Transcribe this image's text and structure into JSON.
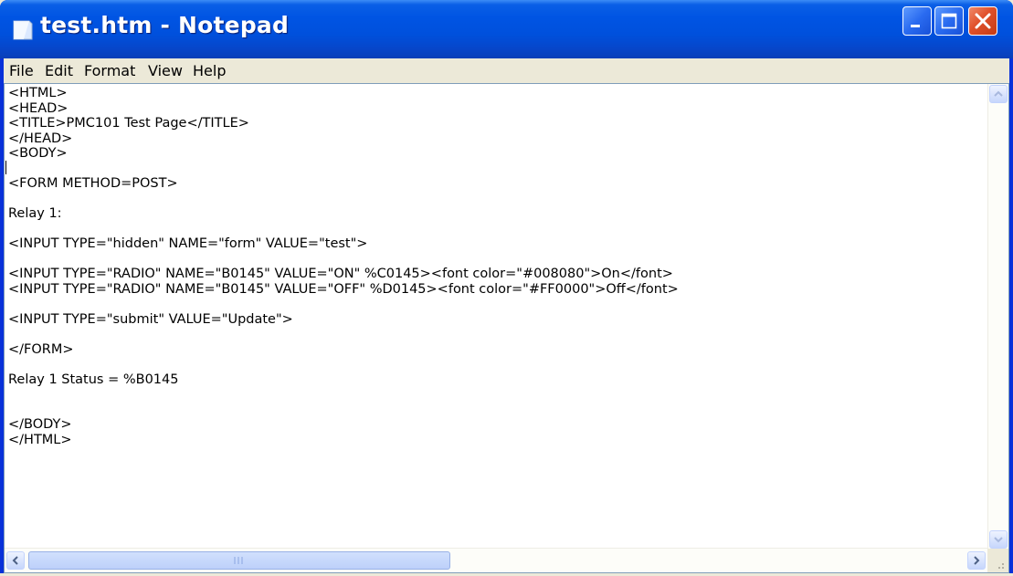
{
  "window": {
    "title": "test.htm - Notepad"
  },
  "menu": {
    "items": [
      "File",
      "Edit",
      "Format",
      "View",
      "Help"
    ]
  },
  "editor": {
    "lines": [
      "<HTML>",
      "<HEAD>",
      "<TITLE>PMC101 Test Page</TITLE>",
      "</HEAD>",
      "<BODY>",
      "",
      "<FORM METHOD=POST>",
      "",
      "Relay 1:",
      "",
      "<INPUT TYPE=\"hidden\" NAME=\"form\" VALUE=\"test\">",
      "",
      "<INPUT TYPE=\"RADIO\" NAME=\"B0145\" VALUE=\"ON\" %C0145><font color=\"#008080\">On</font>",
      "<INPUT TYPE=\"RADIO\" NAME=\"B0145\" VALUE=\"OFF\" %D0145><font color=\"#FF0000\">Off</font>",
      "",
      "<INPUT TYPE=\"submit\" VALUE=\"Update\">",
      "",
      "</FORM>",
      "",
      "Relay 1 Status = %B0145",
      "",
      "",
      "</BODY>",
      "</HTML>"
    ]
  },
  "colors": {
    "titlebar": "#0054e3",
    "close_button": "#e0502a",
    "menubar": "#ece9d8"
  },
  "icons": {
    "app": "notepad-icon",
    "minimize": "minimize-icon",
    "maximize": "maximize-icon",
    "close": "close-icon"
  }
}
